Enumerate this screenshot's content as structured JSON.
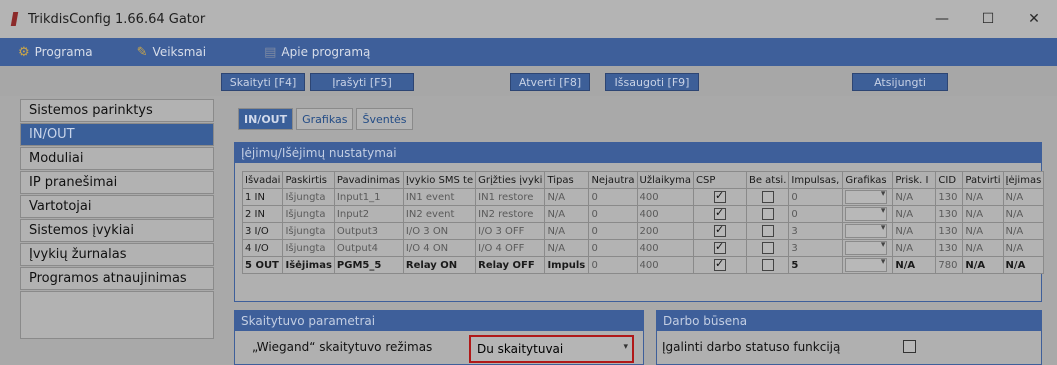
{
  "window": {
    "title": "TrikdisConfig 1.66.64   Gator",
    "minimize": "—",
    "maximize": "☐",
    "close": "✕"
  },
  "menu": {
    "items": [
      {
        "label": "Programa",
        "icon": "gear-icon"
      },
      {
        "label": "Veiksmai",
        "icon": "wrench-icon"
      },
      {
        "label": "Apie programą",
        "icon": "info-window-icon"
      }
    ]
  },
  "toolbar": {
    "read": "Skaityti [F4]",
    "write": "Įrašyti [F5]",
    "open": "Atverti [F8]",
    "save": "Išsaugoti [F9]",
    "disconnect": "Atsijungti"
  },
  "sidebar": {
    "items": [
      {
        "label": "Sistemos parinktys",
        "active": false
      },
      {
        "label": "IN/OUT",
        "active": true
      },
      {
        "label": "Moduliai",
        "active": false
      },
      {
        "label": "IP pranešimai",
        "active": false
      },
      {
        "label": "Vartotojai",
        "active": false
      },
      {
        "label": "Sistemos įvykiai",
        "active": false
      },
      {
        "label": "Įvykių žurnalas",
        "active": false
      },
      {
        "label": "Programos atnaujinimas",
        "active": false
      }
    ]
  },
  "tabs": [
    {
      "label": "IN/OUT",
      "active": true
    },
    {
      "label": "Grafikas",
      "active": false
    },
    {
      "label": "Šventės",
      "active": false
    }
  ],
  "io_panel": {
    "title": "Įėjimų/Išėjimų nustatymai",
    "columns": [
      "Išvadai",
      "Paskirtis",
      "Pavadinimas",
      "Įvykio SMS te",
      "Grįžties įvyki",
      "Tipas",
      "Nejautra",
      "Užlaikyma",
      "CSP",
      "Be atsi.",
      "Impulsas,",
      "Grafikas",
      "Prisk. I",
      "CID",
      "Patvirti",
      "Įėjimas"
    ],
    "rows": [
      {
        "pin": "1 IN",
        "purpose": "Išjungta",
        "name": "Input1_1",
        "event": "IN1 event",
        "restore": "IN1 restore",
        "type": "N/A",
        "insens": "0",
        "delay": "400",
        "csp": true,
        "be": false,
        "impulse": "0",
        "prisk": "N/A",
        "cid": "130",
        "patv": "N/A",
        "ieji": "N/A",
        "bold": false
      },
      {
        "pin": "2 IN",
        "purpose": "Išjungta",
        "name": "Input2",
        "event": "IN2 event",
        "restore": "IN2 restore",
        "type": "N/A",
        "insens": "0",
        "delay": "400",
        "csp": true,
        "be": false,
        "impulse": "0",
        "prisk": "N/A",
        "cid": "130",
        "patv": "N/A",
        "ieji": "N/A",
        "bold": false
      },
      {
        "pin": "3 I/O",
        "purpose": "Išjungta",
        "name": "Output3",
        "event": "I/O 3 ON",
        "restore": "I/O 3 OFF",
        "type": "N/A",
        "insens": "0",
        "delay": "200",
        "csp": true,
        "be": false,
        "impulse": "3",
        "prisk": "N/A",
        "cid": "130",
        "patv": "N/A",
        "ieji": "N/A",
        "bold": false
      },
      {
        "pin": "4 I/O",
        "purpose": "Išjungta",
        "name": "Output4",
        "event": "I/O 4 ON",
        "restore": "I/O 4 OFF",
        "type": "N/A",
        "insens": "0",
        "delay": "400",
        "csp": true,
        "be": false,
        "impulse": "3",
        "prisk": "N/A",
        "cid": "130",
        "patv": "N/A",
        "ieji": "N/A",
        "bold": false
      },
      {
        "pin": "5 OUT",
        "purpose": "Išėjimas",
        "name": "PGM5_5",
        "event": "Relay ON",
        "restore": "Relay OFF",
        "type": "Impuls",
        "insens": "0",
        "delay": "400",
        "csp": true,
        "be": false,
        "impulse": "5",
        "prisk": "N/A",
        "cid": "780",
        "patv": "N/A",
        "ieji": "N/A",
        "bold": true
      }
    ]
  },
  "reader_panel": {
    "title": "Skaitytuvo parametrai",
    "mode_label": "„Wiegand“ skaitytuvo režimas",
    "mode_value": "Du skaitytuvai"
  },
  "status_panel": {
    "title": "Darbo būsena",
    "enable_label": "Įgalinti darbo statuso funkciją",
    "enabled": false
  },
  "colors": {
    "accent": "#3e5f9a",
    "highlight_border": "#b01818"
  }
}
